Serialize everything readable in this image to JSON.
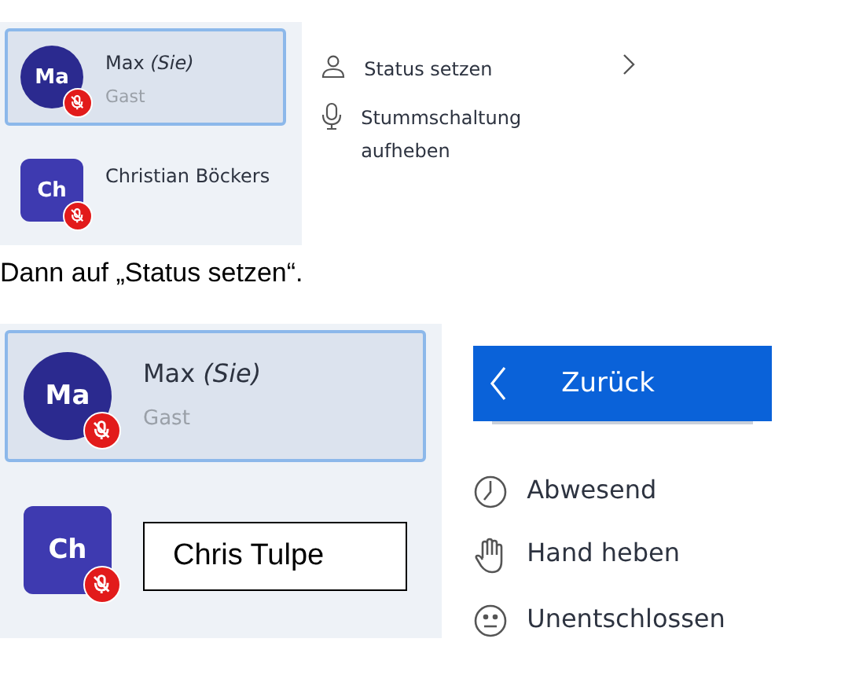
{
  "screenshots": [
    {
      "participants": [
        {
          "initials": "Ma",
          "kind": "circle",
          "name": "Max *(Sie)*",
          "role": "Gast",
          "muted": true,
          "selected": true
        },
        {
          "initials": "Ch",
          "kind": "square",
          "name": "Christian Böckers",
          "muted": true,
          "selected": false
        }
      ],
      "menu": [
        {
          "kind": "person",
          "label": "Status setzen",
          "submenu": true
        },
        {
          "kind": "mic",
          "label": "Stummschaltung aufheben",
          "submenu": false
        }
      ]
    },
    {
      "participants": [
        {
          "initials": "Ma",
          "kind": "circle",
          "name": "Max *(Sie)*",
          "role": "Gast",
          "muted": true,
          "selected": true
        },
        {
          "initials": "Ch",
          "kind": "square",
          "name": "Chris Tulpe",
          "boxed": true,
          "muted": true,
          "selected": false
        }
      ],
      "menu": [
        {
          "kind": "back",
          "label": "Zurück",
          "submenu": false
        },
        {
          "kind": "clock",
          "label": "Abwesend",
          "submenu": false
        },
        {
          "kind": "hand",
          "label": "Hand heben",
          "submenu": false
        },
        {
          "kind": "face",
          "label": "Unentschlossen",
          "submenu": false
        }
      ]
    }
  ],
  "caption": "Dann auf „Status setzen“."
}
